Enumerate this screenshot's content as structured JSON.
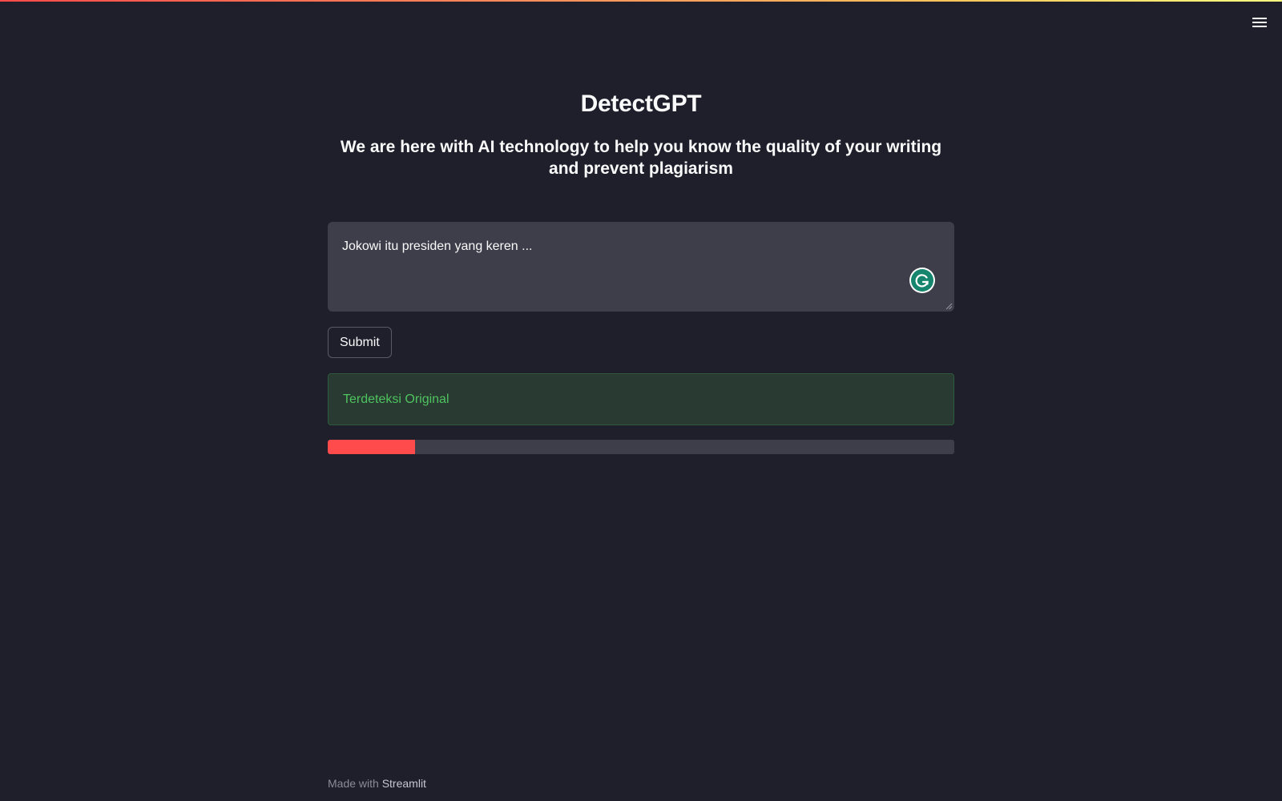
{
  "app": {
    "title": "DetectGPT",
    "subtitle": "We are here with AI technology to help you know the quality of your writing and prevent plagiarism"
  },
  "input": {
    "value": "Jokowi itu presiden yang keren ..."
  },
  "submit_button": {
    "label": "Submit"
  },
  "result": {
    "message": "Terdeteksi Original",
    "status": "success"
  },
  "progress": {
    "value_fraction": 0.14
  },
  "footer": {
    "prefix": "Made with",
    "brand": "Streamlit"
  },
  "icons": {
    "menu": "hamburger-menu-icon",
    "grammarly": "grammarly-icon",
    "resize": "resize-handle-icon"
  },
  "colors": {
    "background": "#1f1e2b",
    "accent": "#ff4b4b",
    "success_text": "#4fc35f",
    "success_bg": "#283a31"
  }
}
